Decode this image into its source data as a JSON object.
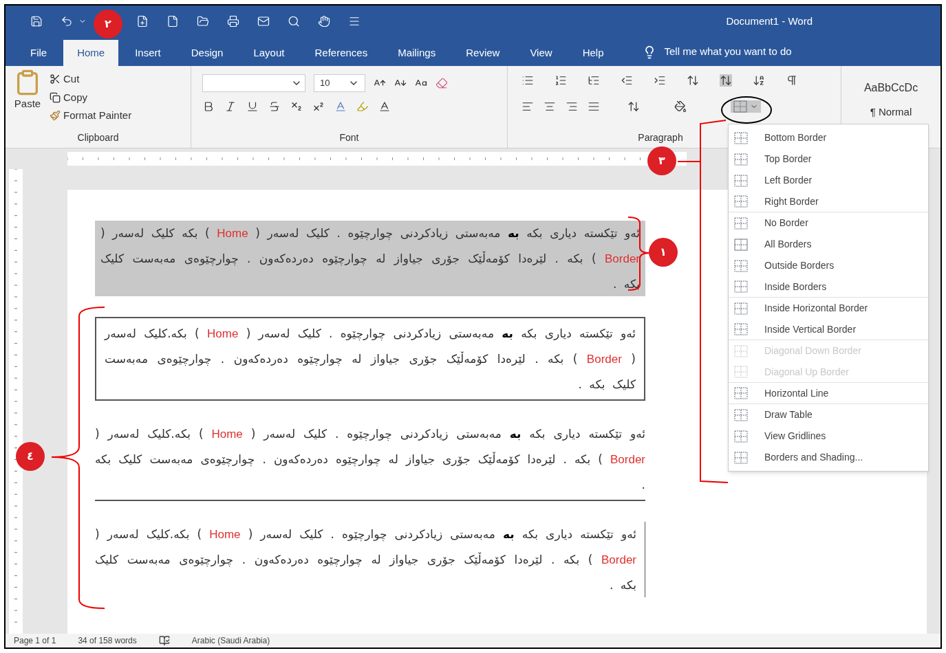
{
  "window": {
    "title": "Document1  -  Word"
  },
  "tabs": [
    {
      "label": "File",
      "selected": false
    },
    {
      "label": "Home",
      "selected": true
    },
    {
      "label": "Insert",
      "selected": false
    },
    {
      "label": "Design",
      "selected": false
    },
    {
      "label": "Layout",
      "selected": false
    },
    {
      "label": "References",
      "selected": false
    },
    {
      "label": "Mailings",
      "selected": false
    },
    {
      "label": "Review",
      "selected": false
    },
    {
      "label": "View",
      "selected": false
    },
    {
      "label": "Help",
      "selected": false
    }
  ],
  "tell_me": "Tell me what you want to do",
  "ribbon": {
    "clipboard": {
      "paste": "Paste",
      "cut": "Cut",
      "copy": "Copy",
      "format_painter": "Format Painter",
      "label": "Clipboard"
    },
    "font": {
      "size": "10",
      "label": "Font"
    },
    "paragraph": {
      "label": "Paragraph"
    },
    "styles": {
      "preview": "AaBbCcDc",
      "name": "¶ Normal"
    }
  },
  "border_menu": [
    {
      "label": "Bottom Border",
      "disabled": false,
      "divider": false
    },
    {
      "label": "Top Border",
      "disabled": false,
      "divider": false
    },
    {
      "label": "Left Border",
      "disabled": false,
      "divider": false
    },
    {
      "label": "Right Border",
      "disabled": false,
      "divider": true
    },
    {
      "label": "No Border",
      "disabled": false,
      "divider": false
    },
    {
      "label": "All Borders",
      "disabled": false,
      "divider": false
    },
    {
      "label": "Outside Borders",
      "disabled": false,
      "divider": false
    },
    {
      "label": "Inside Borders",
      "disabled": false,
      "divider": true
    },
    {
      "label": "Inside Horizontal Border",
      "disabled": false,
      "divider": false
    },
    {
      "label": "Inside Vertical Border",
      "disabled": false,
      "divider": true
    },
    {
      "label": "Diagonal Down Border",
      "disabled": true,
      "divider": false
    },
    {
      "label": "Diagonal Up Border",
      "disabled": true,
      "divider": true
    },
    {
      "label": "Horizontal Line",
      "disabled": false,
      "divider": true
    },
    {
      "label": "Draw Table",
      "disabled": false,
      "divider": false
    },
    {
      "label": "View Gridlines",
      "disabled": false,
      "divider": false
    },
    {
      "label": "Borders and Shading...",
      "disabled": false,
      "divider": false
    }
  ],
  "paragraphs": [
    {
      "kind": "shading",
      "runs": [
        {
          "kind": "text",
          "text": "ئەو تێکستە دیاری بکە "
        },
        {
          "kind": "bold",
          "text": "بە"
        },
        {
          "kind": "text",
          "text": " مەبەستی زیادکردنی چوارچێوە . کلیک لەسەر ( "
        },
        {
          "kind": "english",
          "text": "Home"
        },
        {
          "kind": "text",
          "text": " ) بکە کلیک لەسەر ( "
        },
        {
          "kind": "english",
          "text": "Border"
        },
        {
          "kind": "text",
          "text": " ) بکە . لێرەدا کۆمەڵێک جۆری جیاواز لە چوارچێوە دەردەکەون . چوارچێوەی مەبەست کلیک بکە ."
        }
      ]
    },
    {
      "kind": "box",
      "runs": [
        {
          "kind": "text",
          "text": "ئەو تێکستە دیاری بکە "
        },
        {
          "kind": "bold",
          "text": "بە"
        },
        {
          "kind": "text",
          "text": " مەبەستی زیادکردنی چوارچێوە . کلیک لەسەر ( "
        },
        {
          "kind": "english",
          "text": "Home"
        },
        {
          "kind": "text",
          "text": " ) بکە.کلیک لەسەر ( "
        },
        {
          "kind": "english",
          "text": "Border"
        },
        {
          "kind": "text",
          "text": " ) بکە . لێرەدا کۆمەڵێک جۆری جیاواز لە چوارچێوە دەردەکەون . چوارچێوەی مەبەست کلیک بکە ."
        }
      ]
    },
    {
      "kind": "bottom",
      "runs": [
        {
          "kind": "text",
          "text": "ئەو تێکستە دیاری بکە "
        },
        {
          "kind": "bold",
          "text": "بە"
        },
        {
          "kind": "text",
          "text": " مەبەستی زیادکردنی چوارچێوە . کلیک لەسەر ( "
        },
        {
          "kind": "english",
          "text": "Home"
        },
        {
          "kind": "text",
          "text": " ) بکە.کلیک لەسەر ( "
        },
        {
          "kind": "english",
          "text": "Border"
        },
        {
          "kind": "text",
          "text": " ) بکە . لێرەدا کۆمەڵێک جۆری جیاواز لە چوارچێوە دەردەکەون . چوارچێوەی مەبەست کلیک بکە ."
        }
      ]
    },
    {
      "kind": "right",
      "runs": [
        {
          "kind": "text",
          "text": "ئەو تێکستە دیاری بکە "
        },
        {
          "kind": "bold",
          "text": "بە"
        },
        {
          "kind": "text",
          "text": " مەبەستی زیادکردنی چوارچێوە . کلیک لەسەر ( "
        },
        {
          "kind": "english",
          "text": "Home"
        },
        {
          "kind": "text",
          "text": " ) بکە.کلیک لەسەر ( "
        },
        {
          "kind": "english",
          "text": "Border"
        },
        {
          "kind": "text",
          "text": " ) بکە . لێرەدا کۆمەڵێک جۆری جیاواز لە چوارچێوە دەردەکەون . چوارچێوەی مەبەست کلیک بکە ."
        }
      ]
    }
  ],
  "callouts": [
    {
      "label": "٢"
    },
    {
      "label": "٣"
    },
    {
      "label": "١"
    },
    {
      "label": "٤"
    }
  ],
  "status_bar": {
    "page": "Page 1 of 1",
    "words": "34 of 158 words",
    "language": "Arabic (Saudi Arabia)"
  }
}
